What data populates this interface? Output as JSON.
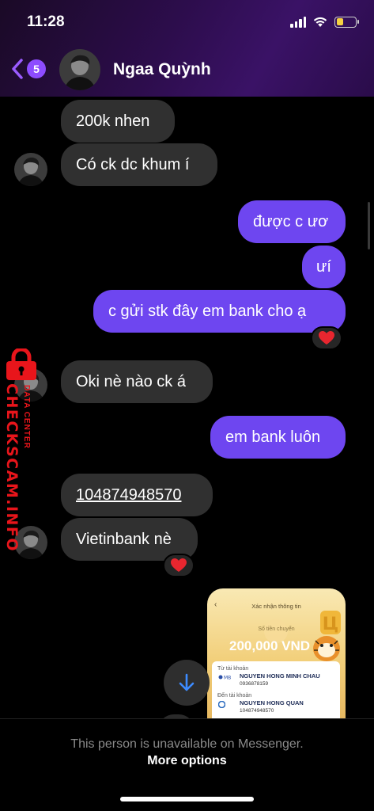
{
  "status_bar": {
    "time": "11:28",
    "signal_icon": "cellular-signal-icon",
    "wifi_icon": "wifi-icon",
    "battery_icon": "battery-icon",
    "battery_level": 0.35,
    "battery_color": "#f5d142"
  },
  "header": {
    "back_icon": "chevron-left-icon",
    "unread_count": "5",
    "contact_name": "Ngaa Quỳnh",
    "accent_color": "#8d4cff"
  },
  "messages": [
    {
      "direction": "incoming",
      "text": "200k nhen"
    },
    {
      "direction": "incoming",
      "text": "Có ck dc khum í"
    },
    {
      "direction": "outgoing",
      "text": "được c ươ"
    },
    {
      "direction": "outgoing",
      "text": "ưí"
    },
    {
      "direction": "outgoing",
      "text": "c gửi stk đây em bank cho ạ",
      "reaction": "heart"
    },
    {
      "direction": "incoming",
      "text": "Oki nè nào ck á"
    },
    {
      "direction": "outgoing",
      "text": "em bank luôn"
    },
    {
      "direction": "incoming",
      "text": "104874948570",
      "is_link": true
    },
    {
      "direction": "incoming",
      "text": "Vietinbank nè",
      "reaction": "heart"
    }
  ],
  "receipt_image": {
    "screen_title": "Xác nhận thông tin",
    "amount_label": "Số tiền chuyển",
    "amount": "200,000 VND",
    "from_label": "Từ tài khoản",
    "from_name": "NGUYEN HONG MINH CHAU",
    "from_number": "0936878159",
    "to_label": "Đến tài khoản",
    "to_name": "NGUYEN HONG QUAN",
    "to_number": "104874948570"
  },
  "watermark": {
    "brand": "CHECKSCAM.INFO",
    "subtitle": "DATA CENTER"
  },
  "footer": {
    "notice": "This person is unavailable on Messenger.",
    "action": "More options"
  },
  "colors": {
    "outgoing_bubble": "#6e46f0",
    "incoming_bubble": "#303030",
    "watermark_red": "#e8151b"
  }
}
